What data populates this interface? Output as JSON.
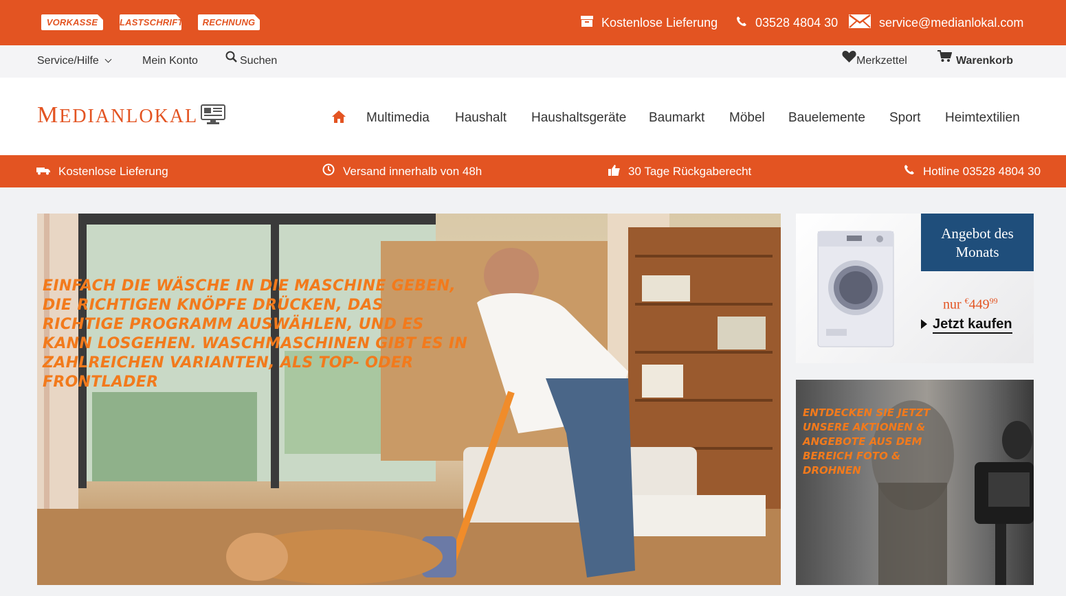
{
  "payment_methods": [
    "VORKASSE",
    "LASTSCHRIFT",
    "RECHNUNG"
  ],
  "top_info": {
    "delivery": "Kostenlose Lieferung",
    "phone": "03528 4804 30",
    "email": "service@medianlokal.com"
  },
  "secondary_nav": {
    "service": "Service/Hilfe",
    "account": "Mein Konto",
    "search": "Suchen",
    "wishlist": "Merkzettel",
    "cart": "Warenkorb"
  },
  "logo": {
    "first": "M",
    "rest": "EDIANLOKAL"
  },
  "main_nav": [
    "Multimedia",
    "Haushalt",
    "Haushaltsgeräte",
    "Baumarkt",
    "Möbel",
    "Bauelemente",
    "Sport",
    "Heimtextilien"
  ],
  "usp": [
    {
      "label": "Kostenlose Lieferung",
      "icon": "truck-icon"
    },
    {
      "label": "Versand innerhalb von 48h",
      "icon": "clock-icon"
    },
    {
      "label": "30 Tage Rückgaberecht",
      "icon": "thumbs-up-icon"
    },
    {
      "label": "Hotline 03528 4804 30",
      "icon": "phone-icon"
    }
  ],
  "hero": {
    "text": "Einfach die Wäsche in die Maschine geben, die richtigen Knöpfe drücken, das richtige Programm auswählen, und es kann losgehen. Waschmaschinen gibt es in zahlreichen Varianten, als Top- oder Frontlader"
  },
  "offer": {
    "title": "Angebot des Monats",
    "price_prefix": "nur",
    "currency": "€",
    "price_main": "449",
    "price_cents": "99",
    "cta": "Jetzt kaufen"
  },
  "promo": {
    "text": "Entdecken Sie jetzt unsere Aktionen & Angebote aus dem Bereich Foto & Drohnen"
  },
  "colors": {
    "brand": "#e35422",
    "offer_box": "#1f4e7b",
    "light_bar": "#f4f4f6"
  }
}
